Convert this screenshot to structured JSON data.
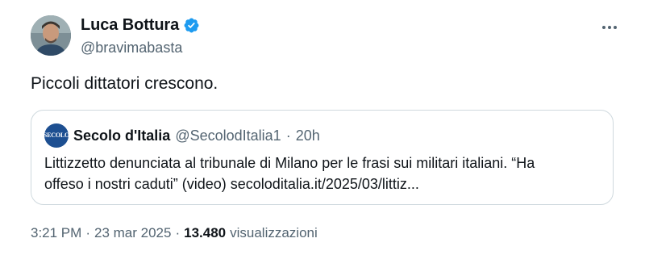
{
  "author": {
    "display_name": "Luca Bottura",
    "handle": "@bravimabasta",
    "verified": true,
    "avatar_icon": "user-photo-avatar"
  },
  "tweet": {
    "text": "Piccoli dittatori crescono."
  },
  "quote": {
    "avatar_text": "SECOLO",
    "display_name": "Secolo d'Italia",
    "handle": "@SecolodItalia1",
    "separator": "·",
    "time": "20h",
    "body_line1": "Littizzetto denunciata al tribunale di Milano per le frasi sui militari italiani. “Ha",
    "body_line2": "offeso i nostri caduti” (video) secoloditalia.it/2025/03/littiz..."
  },
  "meta": {
    "time": "3:21 PM",
    "sep1": "·",
    "date": "23 mar 2025",
    "sep2": "·",
    "views_count": "13.480",
    "views_label": "visualizzazioni"
  },
  "colors": {
    "verified_blue": "#1d9bf0",
    "secondary_text": "#536471",
    "border": "#cfd9de"
  },
  "icons": {
    "verified": "verified-badge-icon",
    "more": "more-options-icon"
  }
}
